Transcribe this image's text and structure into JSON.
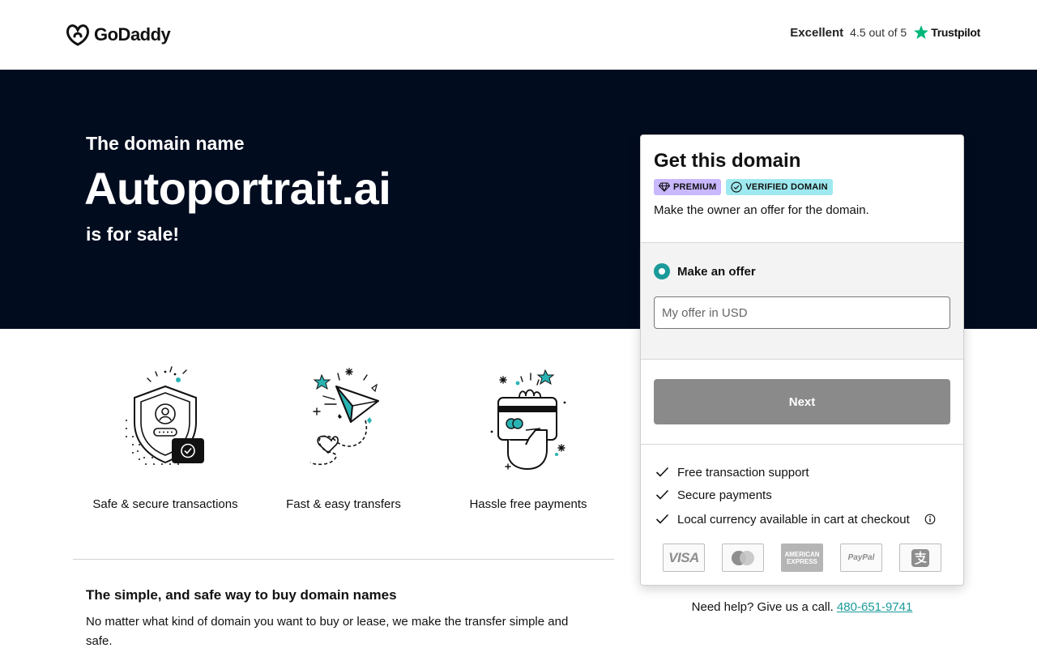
{
  "header": {
    "logo_text": "GoDaddy",
    "trust_rating": "Excellent",
    "trust_score": "4.5 out of 5",
    "trust_brand": "Trustpilot"
  },
  "hero": {
    "pre": "The domain name",
    "domain": "Autoportrait.ai",
    "post": "is for sale!"
  },
  "features": [
    {
      "label": "Safe & secure transactions",
      "icon": "shield-user-icon"
    },
    {
      "label": "Fast & easy transfers",
      "icon": "paper-plane-icon"
    },
    {
      "label": "Hassle free payments",
      "icon": "card-hand-icon"
    }
  ],
  "info": {
    "title": "The simple, and safe way to buy domain names",
    "body": "No matter what kind of domain you want to buy or lease, we make the transfer simple and safe."
  },
  "card": {
    "title": "Get this domain",
    "badge_premium": "PREMIUM",
    "badge_verified": "VERIFIED DOMAIN",
    "subtitle": "Make the owner an offer for the domain.",
    "offer_label": "Make an offer",
    "offer_placeholder": "My offer in USD",
    "next_label": "Next",
    "checks": [
      "Free transaction support",
      "Secure payments",
      "Local currency available in cart at checkout"
    ],
    "payments": {
      "visa": "VISA",
      "amex_line1": "AMERICAN",
      "amex_line2": "EXPRESS",
      "paypal": "PayPal"
    }
  },
  "help": {
    "text": "Need help? Give us a call.",
    "phone": "480-651-9741"
  },
  "colors": {
    "hero_bg": "#020c1f",
    "accent_teal": "#1a9a9a",
    "button_disabled": "#8a8a8a",
    "badge_premium": "#c9b7ff",
    "badge_verified": "#9ee9ef",
    "trustpilot_green": "#00b67a"
  }
}
